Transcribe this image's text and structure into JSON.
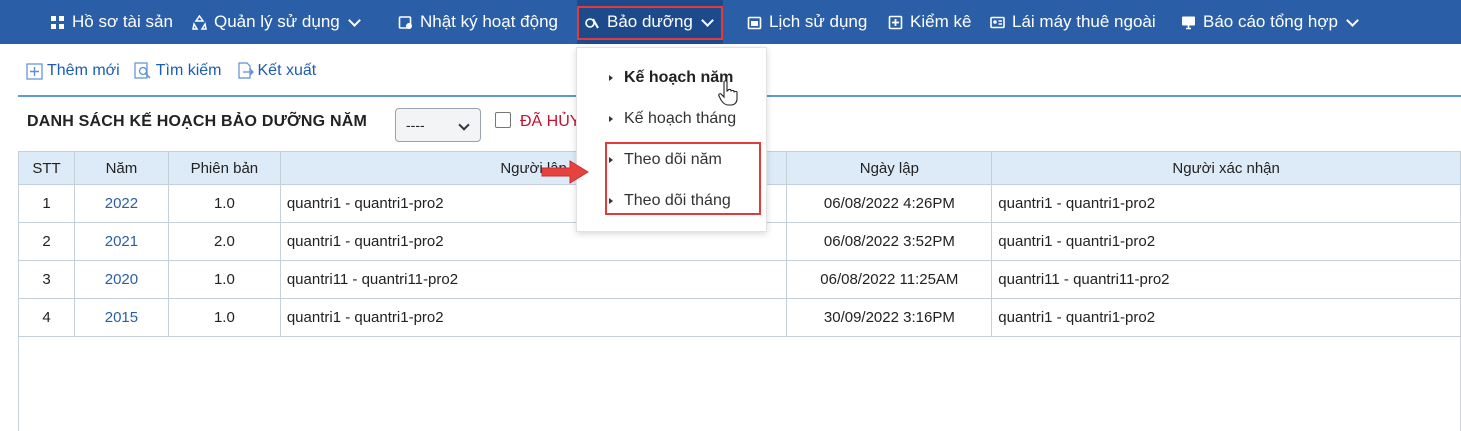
{
  "nav": {
    "items": [
      {
        "label": "Hồ sơ tài sản",
        "icon": "grid-icon",
        "has_dropdown": false
      },
      {
        "label": "Quản lý sử dụng",
        "icon": "recycle-icon",
        "has_dropdown": true
      },
      {
        "label": "Nhật ký hoạt động",
        "icon": "log-icon",
        "has_dropdown": false
      },
      {
        "label": "Bảo dưỡng",
        "icon": "maintenance-icon",
        "has_dropdown": true,
        "active": true
      },
      {
        "label": "Lịch sử dụng",
        "icon": "calendar-icon",
        "has_dropdown": false
      },
      {
        "label": "Kiểm kê",
        "icon": "inventory-icon",
        "has_dropdown": false
      },
      {
        "label": "Lái máy thuê ngoài",
        "icon": "id-card-icon",
        "has_dropdown": false
      },
      {
        "label": "Báo cáo tổng hợp",
        "icon": "monitor-icon",
        "has_dropdown": true
      }
    ]
  },
  "toolbar": {
    "add_label": "Thêm mới",
    "search_label": "Tìm kiếm",
    "export_label": "Kết xuất"
  },
  "list": {
    "title": "DANH SÁCH KẾ HOẠCH BẢO DƯỠNG NĂM",
    "year_select_value": "----",
    "cancelled_label": "ĐÃ HỦY"
  },
  "table": {
    "headers": [
      "STT",
      "Năm",
      "Phiên bản",
      "Người lập",
      "Ngày lập",
      "Người xác nhận"
    ],
    "rows": [
      [
        "1",
        "2022",
        "1.0",
        "quantri1 - quantri1-pro2",
        "06/08/2022 4:26PM",
        "quantri1 - quantri1-pro2"
      ],
      [
        "2",
        "2021",
        "2.0",
        "quantri1 - quantri1-pro2",
        "06/08/2022 3:52PM",
        "quantri1 - quantri1-pro2"
      ],
      [
        "3",
        "2020",
        "1.0",
        "quantri11 - quantri11-pro2",
        "06/08/2022 11:25AM",
        "quantri11 - quantri11-pro2"
      ],
      [
        "4",
        "2015",
        "1.0",
        "quantri1 - quantri1-pro2",
        "30/09/2022 3:16PM",
        "quantri1 - quantri1-pro2"
      ]
    ]
  },
  "dropdown": {
    "items": [
      "Kế hoạch năm",
      "Kế hoạch tháng",
      "Theo dõi năm",
      "Theo dõi tháng"
    ]
  },
  "colors": {
    "nav_bg": "#2a5fa7",
    "accent": "#e23b3b",
    "link": "#2a5fa7",
    "header_bg": "#ddeaf7"
  }
}
